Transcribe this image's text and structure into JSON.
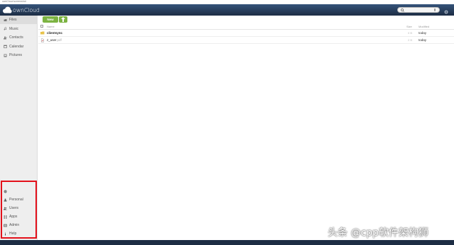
{
  "window": {
    "title": "ownCloud screenshot"
  },
  "header": {
    "logo_text": "ownCloud",
    "search_placeholder": ""
  },
  "sidebar": {
    "items": [
      {
        "label": "Files",
        "icon": "folder-icon",
        "active": true
      },
      {
        "label": "Music",
        "icon": "music-note-icon",
        "active": false
      },
      {
        "label": "Contacts",
        "icon": "contacts-icon",
        "active": false
      },
      {
        "label": "Calendar",
        "icon": "calendar-icon",
        "active": false
      },
      {
        "label": "Pictures",
        "icon": "picture-icon",
        "active": false
      }
    ],
    "bottom_items": [
      {
        "label": "",
        "icon": "gear-icon"
      },
      {
        "label": "Personal",
        "icon": "person-icon"
      },
      {
        "label": "Users",
        "icon": "users-icon"
      },
      {
        "label": "Apps",
        "icon": "apps-grid-icon"
      },
      {
        "label": "Admin",
        "icon": "admin-icon"
      },
      {
        "label": "Help",
        "icon": "info-icon"
      }
    ]
  },
  "toolbar": {
    "new_label": "New",
    "upload_icon": "upload-arrow-icon"
  },
  "file_list": {
    "columns": {
      "name": "Name",
      "size": "Size",
      "modified": "Modified"
    },
    "rows": [
      {
        "name": "clientsync",
        "ext": "",
        "type": "folder",
        "size": "0 B",
        "modified": "today"
      },
      {
        "name": "z_user",
        "ext": ".pdf",
        "type": "file",
        "size": "2 B",
        "modified": "today"
      }
    ]
  },
  "watermark": "头条 @cpp软件架构狮",
  "colors": {
    "header": "#1d2d44",
    "accent_green": "#7cb342",
    "highlight_border": "#e3101a",
    "sidebar_bg": "#eeeeee"
  }
}
